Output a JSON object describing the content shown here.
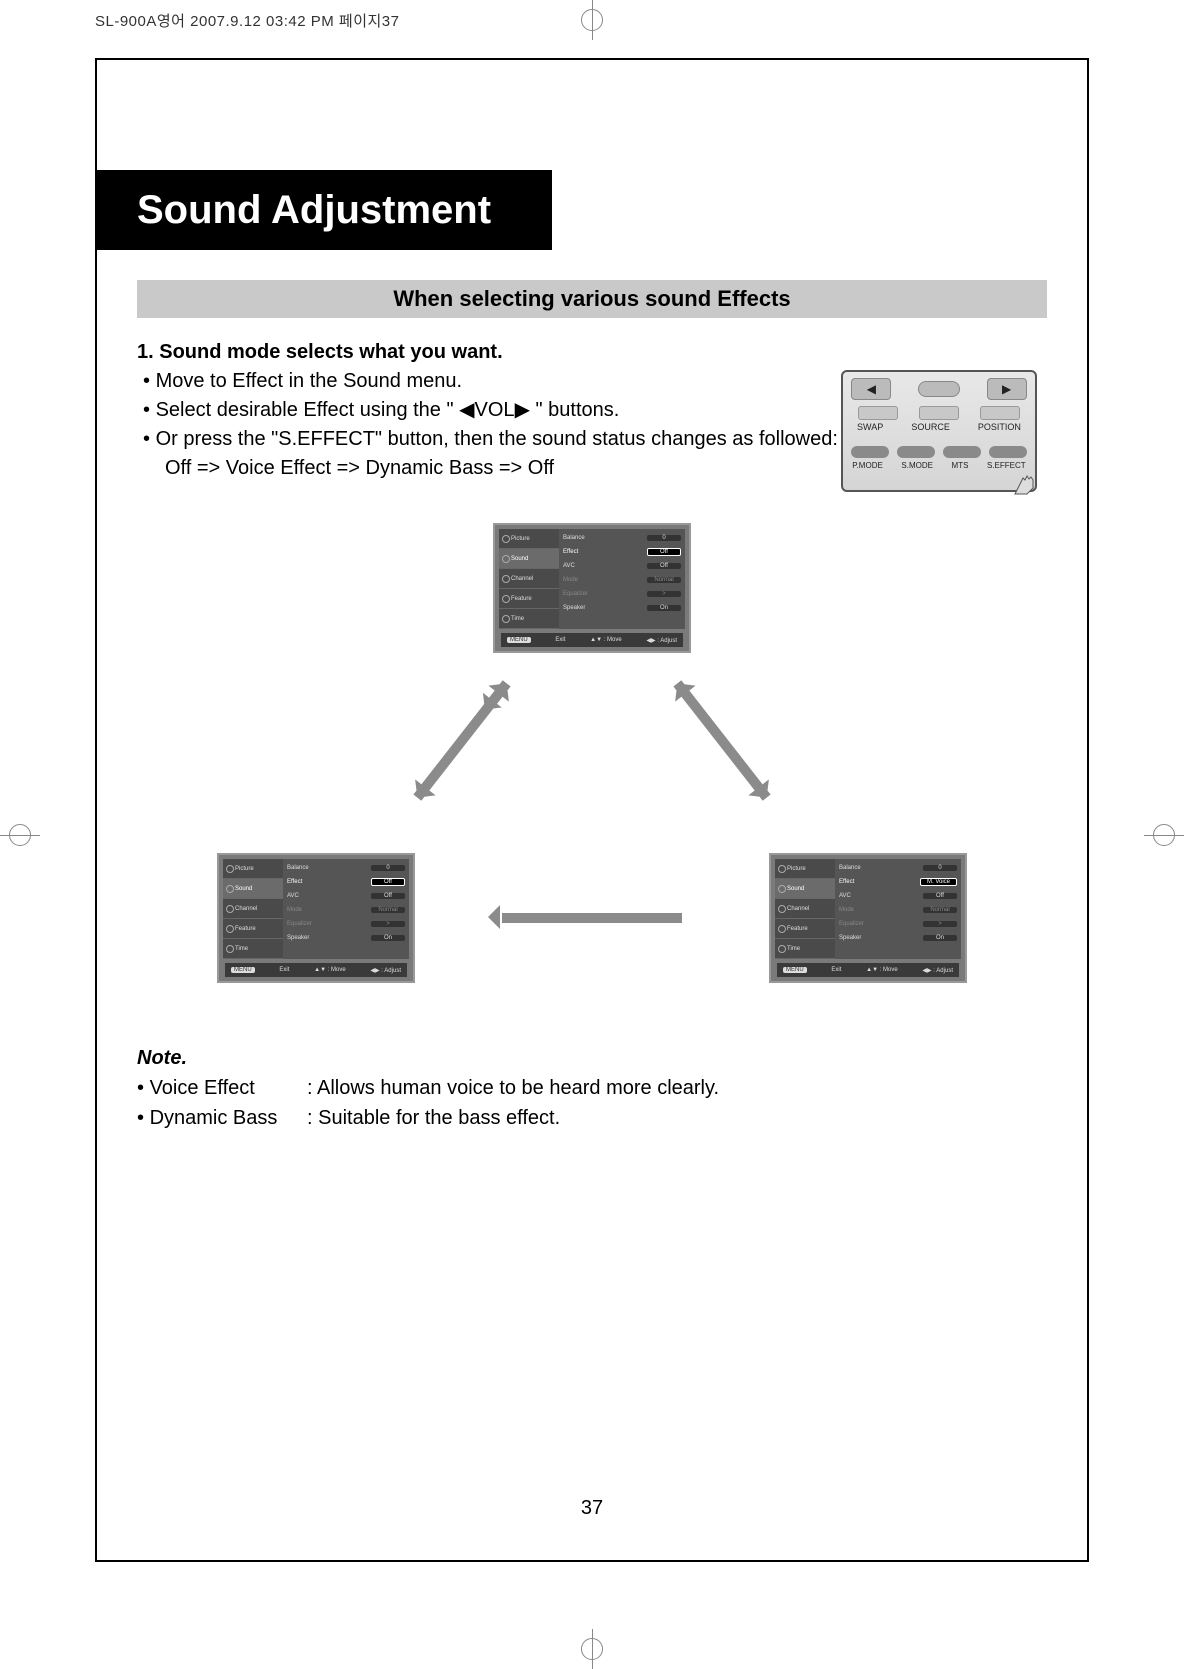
{
  "meta": {
    "header_line": "SL-900A영어  2007.9.12 03:42 PM 페이지37"
  },
  "title": "Sound Adjustment",
  "section_heading": "When selecting various sound Effects",
  "step": {
    "heading": "1. Sound mode selects what you want.",
    "bullet1": "Move to Effect in the Sound menu.",
    "bullet2_pre": "Select desirable Effect using the \" ",
    "bullet2_mid": "VOL",
    "bullet2_post": " \" buttons.",
    "bullet3": "Or press the \"S.EFFECT\" button, then the sound status changes as followed:",
    "bullet3_indent": "Off => Voice Effect => Dynamic Bass => Off"
  },
  "remote": {
    "swap": "SWAP",
    "source": "SOURCE",
    "position": "POSITION",
    "pmode": "P.MODE",
    "smode": "S.MODE",
    "mts": "MTS",
    "seffect": "S.EFFECT"
  },
  "osd": {
    "sidebar": {
      "picture": "Picture",
      "sound": "Sound",
      "channel": "Channel",
      "feature": "Feature",
      "time": "Time"
    },
    "rows": {
      "balance": "Balance",
      "effect": "Effect",
      "avc": "AVC",
      "mode": "Mode",
      "equalizer": "Equalizer",
      "speaker": "Speaker"
    },
    "values": {
      "balance": "0",
      "effect_off": "Off",
      "effect_mvoice": "M. Voice",
      "avc": "Off",
      "mode": "Normal",
      "equalizer": ">",
      "speaker": "On"
    },
    "footer": {
      "exit_key": "MENU",
      "exit": "Exit",
      "move": "▲▼ : Move",
      "adjust": "◀▶ : Adjust"
    }
  },
  "note": {
    "heading": "Note.",
    "row1_term": "Voice Effect",
    "row1_desc": "Allows human voice to be heard more clearly.",
    "row2_term": "Dynamic Bass",
    "row2_desc": "Suitable for the bass effect."
  },
  "page_number": "37"
}
